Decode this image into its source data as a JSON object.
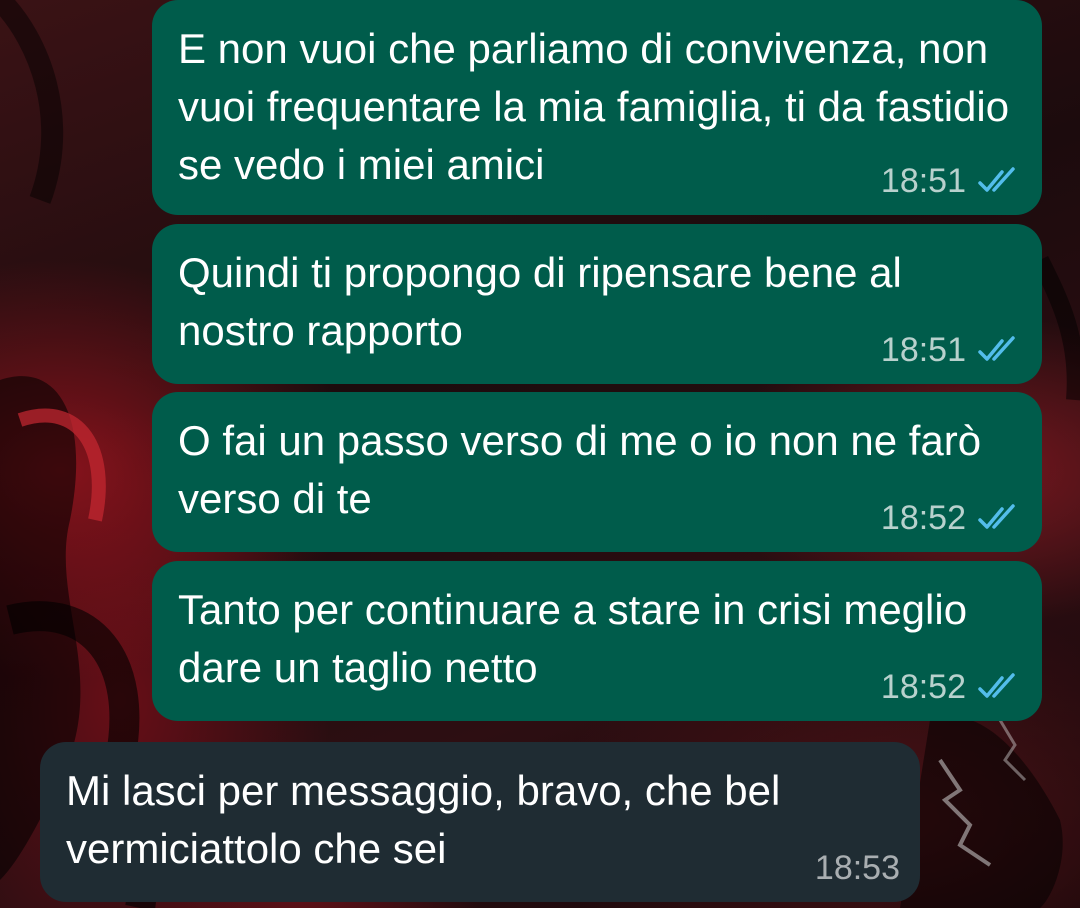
{
  "colors": {
    "outgoing_bubble": "#005c4b",
    "incoming_bubble": "#1f2c33",
    "read_ticks": "#53bdeb",
    "text": "#ffffff"
  },
  "messages": [
    {
      "direction": "outgoing",
      "text": "E non vuoi che parliamo di convivenza, non vuoi frequentare la mia famiglia, ti da fastidio se vedo i miei amici",
      "time": "18:51",
      "status_icon": "double-check-read-icon"
    },
    {
      "direction": "outgoing",
      "text": "Quindi ti propongo di ripensare bene al nostro rapporto",
      "time": "18:51",
      "status_icon": "double-check-read-icon"
    },
    {
      "direction": "outgoing",
      "text": "O fai un passo verso di me o io non ne farò verso di te",
      "time": "18:52",
      "status_icon": "double-check-read-icon"
    },
    {
      "direction": "outgoing",
      "text": "Tanto per continuare a stare in crisi meglio dare un taglio netto",
      "time": "18:52",
      "status_icon": "double-check-read-icon"
    },
    {
      "direction": "incoming",
      "text": "Mi lasci per messaggio, bravo, che bel vermiciattolo che sei",
      "time": "18:53"
    }
  ]
}
